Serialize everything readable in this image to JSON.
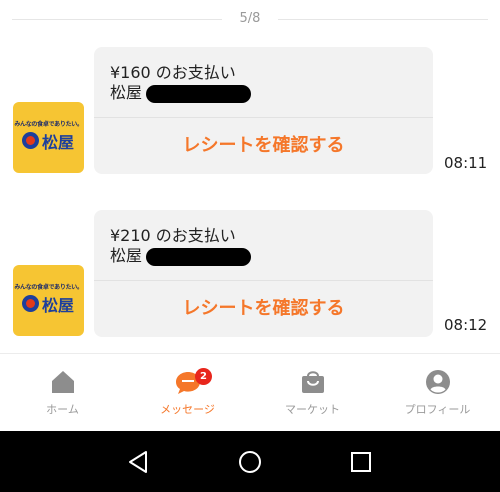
{
  "date_separator": {
    "label": "5/8"
  },
  "messages": [
    {
      "store_logo_tagline": "みんなの食卓でありたい。",
      "store_logo_name": "松屋",
      "amount": "¥160 のお支払い",
      "store": "松屋",
      "action": "レシートを確認する",
      "time": "08:11"
    },
    {
      "store_logo_tagline": "みんなの食卓でありたい。",
      "store_logo_name": "松屋",
      "amount": "¥210 のお支払い",
      "store": "松屋",
      "action": "レシートを確認する",
      "time": "08:12"
    }
  ],
  "tabs": [
    {
      "label": "ホーム",
      "icon": "home-icon"
    },
    {
      "label": "メッセージ",
      "icon": "chat-icon",
      "badge": "2",
      "active": true
    },
    {
      "label": "マーケット",
      "icon": "shopping-bag-icon"
    },
    {
      "label": "プロフィール",
      "icon": "profile-icon"
    }
  ],
  "system_nav": [
    "back-icon",
    "home-circle-icon",
    "recents-icon"
  ],
  "colors": {
    "accent": "#f5772a",
    "badge": "#e8261c",
    "inactive": "#9a9a9a"
  }
}
